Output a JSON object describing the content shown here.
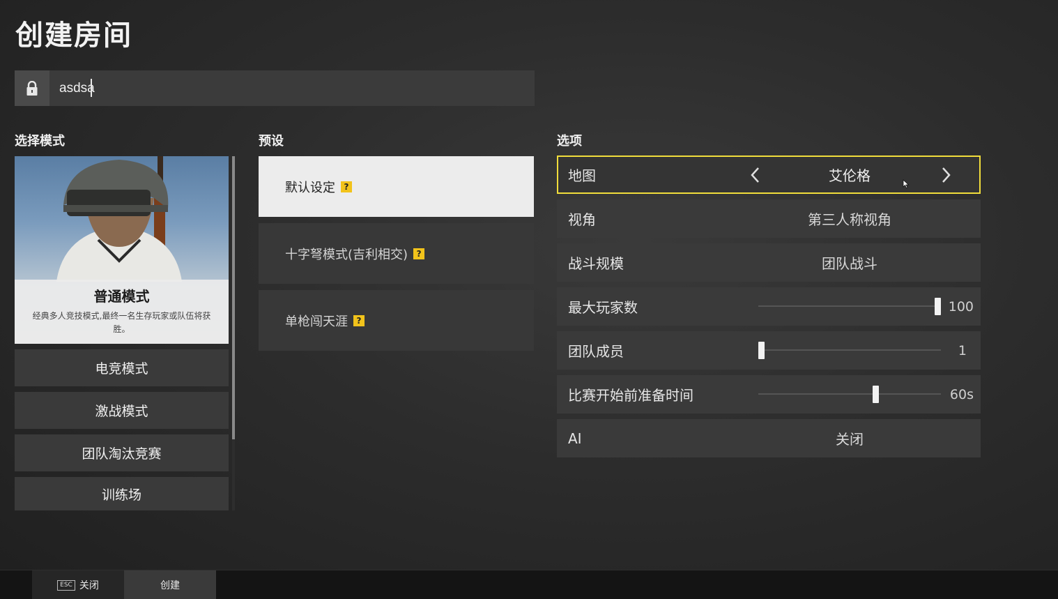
{
  "page_title": "创建房间",
  "room_name": {
    "value": "asdsa",
    "icon": "lock-icon"
  },
  "sections": {
    "modes": "选择模式",
    "presets": "预设",
    "options": "选项"
  },
  "modes": {
    "featured": {
      "title": "普通模式",
      "description": "经典多人竞技模式,最终一名生存玩家或队伍将获胜。"
    },
    "items": [
      "电竞模式",
      "激战模式",
      "团队淘汰竞赛",
      "训练场"
    ]
  },
  "presets": [
    {
      "label": "默认设定",
      "help": "?"
    },
    {
      "label": "十字弩模式(吉利相交)",
      "help": "?"
    },
    {
      "label": "单枪闯天涯",
      "help": "?"
    }
  ],
  "options": {
    "map": {
      "label": "地图",
      "value": "艾伦格"
    },
    "perspective": {
      "label": "视角",
      "value": "第三人称视角"
    },
    "scale": {
      "label": "战斗规模",
      "value": "团队战斗"
    },
    "max_players": {
      "label": "最大玩家数",
      "value": "100",
      "fraction": 1.0
    },
    "team_members": {
      "label": "团队成员",
      "value": "1",
      "fraction": 0.0
    },
    "prep_time": {
      "label": "比赛开始前准备时间",
      "value": "60s",
      "fraction": 0.65
    },
    "ai": {
      "label": "AI",
      "value": "关闭"
    }
  },
  "bottom_bar": {
    "esc_key": "ESC",
    "close": "关闭",
    "create": "创建"
  },
  "colors": {
    "highlight": "#f1dd3b",
    "help_badge": "#f2c31b"
  }
}
